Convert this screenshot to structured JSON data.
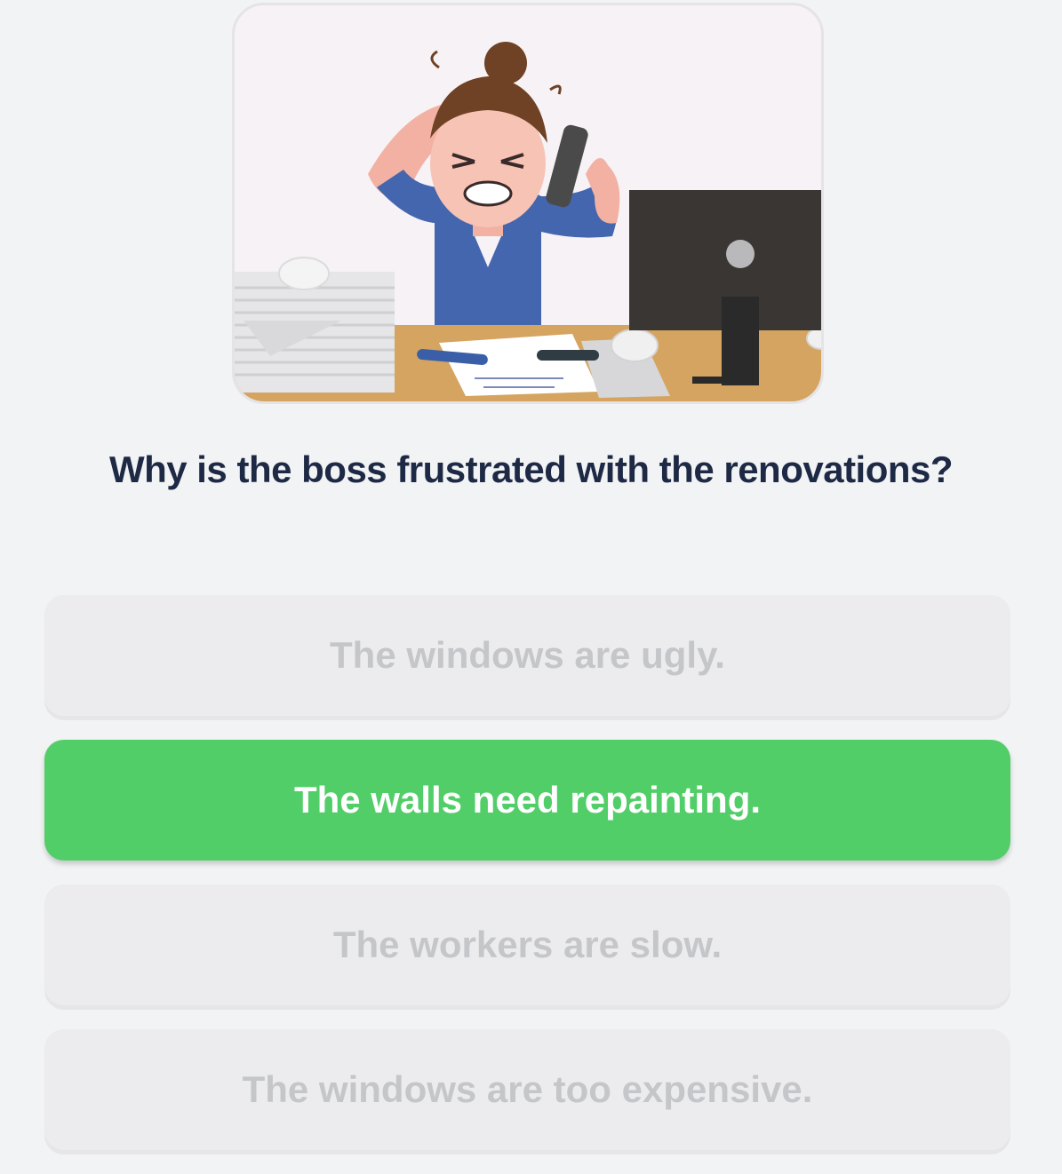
{
  "quiz": {
    "question": "Why is the boss frustrated with the renovations?",
    "illustration_icon": "frustrated-boss-on-phone-illustration",
    "options": [
      {
        "label": "The windows are ugly.",
        "state": "disabled"
      },
      {
        "label": "The walls need repainting.",
        "state": "selected"
      },
      {
        "label": "The workers are slow.",
        "state": "disabled"
      },
      {
        "label": "The windows are too expensive.",
        "state": "disabled"
      }
    ]
  },
  "colors": {
    "background": "#f2f3f5",
    "question_text": "#1e2a45",
    "option_bg": "#ececee",
    "option_text": "#c5c6ca",
    "selected_bg": "#52ce68",
    "selected_text": "#ffffff"
  }
}
